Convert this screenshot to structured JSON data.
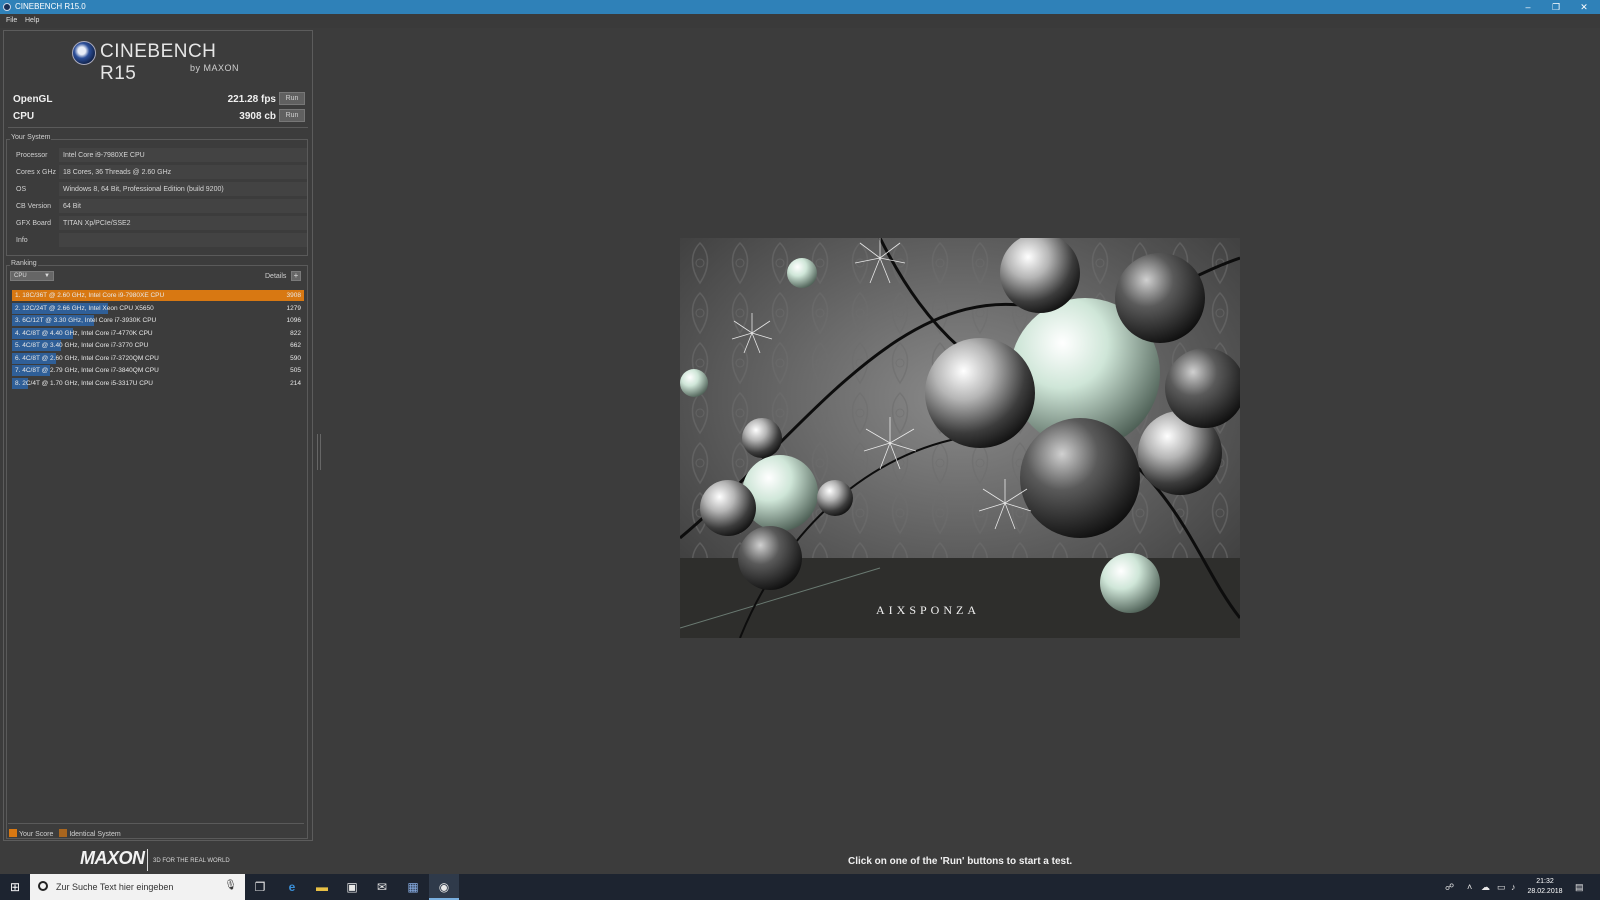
{
  "window": {
    "title": "CINEBENCH R15.0",
    "controls": {
      "minimize": "–",
      "restore": "❐",
      "close": "✕"
    }
  },
  "menu": {
    "items": [
      "File",
      "Help"
    ]
  },
  "brand": {
    "name": "CINEBENCH R15",
    "by": "by MAXON"
  },
  "scores": {
    "opengl": {
      "label": "OpenGL",
      "value": "221.28 fps",
      "run": "Run"
    },
    "cpu": {
      "label": "CPU",
      "value": "3908 cb",
      "run": "Run"
    }
  },
  "system": {
    "title": "Your System",
    "rows": [
      {
        "key": "Processor",
        "value": "Intel Core i9-7980XE CPU"
      },
      {
        "key": "Cores x GHz",
        "value": "18 Cores, 36 Threads @ 2.60 GHz"
      },
      {
        "key": "OS",
        "value": "Windows 8, 64 Bit, Professional Edition (build 9200)"
      },
      {
        "key": "CB Version",
        "value": "64 Bit"
      },
      {
        "key": "GFX Board",
        "value": "TITAN Xp/PCIe/SSE2"
      },
      {
        "key": "Info",
        "value": ""
      }
    ]
  },
  "ranking": {
    "title": "Ranking",
    "selected": "CPU",
    "details_label": "Details",
    "details_btn": "+",
    "max_score": 3908,
    "items": [
      {
        "text": "1. 18C/36T @ 2.60 GHz, Intel Core i9-7980XE CPU",
        "score": 3908,
        "mine": true
      },
      {
        "text": "2. 12C/24T @ 2.66 GHz, Intel Xeon CPU X5650",
        "score": 1279,
        "mine": false
      },
      {
        "text": "3. 6C/12T @ 3.30 GHz,  Intel Core i7-3930K CPU",
        "score": 1096,
        "mine": false
      },
      {
        "text": "4. 4C/8T @ 4.40 GHz, Intel Core i7-4770K CPU",
        "score": 822,
        "mine": false
      },
      {
        "text": "5. 4C/8T @ 3.40 GHz,  Intel Core i7-3770 CPU",
        "score": 662,
        "mine": false
      },
      {
        "text": "6. 4C/8T @ 2.60 GHz, Intel Core i7-3720QM CPU",
        "score": 590,
        "mine": false
      },
      {
        "text": "7. 4C/8T @ 2.79 GHz,  Intel Core i7-3840QM CPU",
        "score": 505,
        "mine": false
      },
      {
        "text": "8. 2C/4T @ 1.70 GHz,  Intel Core i5-3317U CPU",
        "score": 214,
        "mine": false
      }
    ]
  },
  "legend": {
    "your_score": "Your Score",
    "identical": "Identical System",
    "your_color": "#d87812",
    "identical_color": "#a8651e"
  },
  "footer": {
    "logo": "MAXON",
    "tagline": "3D FOR THE REAL WORLD"
  },
  "render": {
    "watermark": "AIXSPONZA"
  },
  "hint": "Click on one of the 'Run' buttons to start a test.",
  "taskbar": {
    "search_placeholder": "Zur Suche Text hier eingeben",
    "time": "21:32",
    "date": "28.02.2018"
  },
  "colors": {
    "titlebar": "#2f81b8",
    "accent_orange": "#d87812",
    "bar_blue": "#2f5f98",
    "background": "#3c3c3c"
  }
}
